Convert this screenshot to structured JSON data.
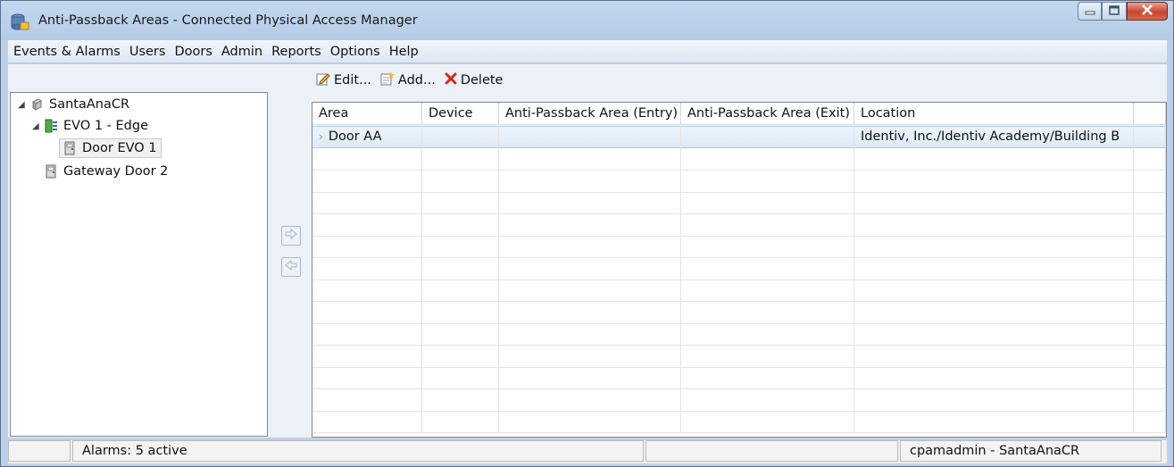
{
  "window": {
    "title": "Anti-Passback Areas - Connected Physical Access Manager",
    "app_icon": "database-icon",
    "controls": {
      "minimize": "minimize-icon",
      "maximize": "maximize-icon",
      "close": "close-icon"
    }
  },
  "menu": {
    "items": [
      "Events & Alarms",
      "Users",
      "Doors",
      "Admin",
      "Reports",
      "Options",
      "Help"
    ]
  },
  "toolbar": {
    "edit_label": "Edit...",
    "add_label": "Add...",
    "delete_label": "Delete"
  },
  "tree": {
    "nodes": [
      {
        "label": "SantaAnaCR",
        "icon": "server-icon",
        "expanded": true
      },
      {
        "label": "EVO 1 - Edge",
        "icon": "controller-icon",
        "expanded": true
      },
      {
        "label": "Door EVO 1",
        "icon": "door-icon"
      },
      {
        "label": "Gateway Door 2",
        "icon": "door-icon"
      }
    ]
  },
  "grid": {
    "columns": [
      "Area",
      "Device",
      "Anti-Passback Area (Entry)",
      "Anti-Passback Area (Exit)",
      "Location"
    ],
    "rows": [
      {
        "area": "Door AA",
        "device": "",
        "entry": "",
        "exit": "",
        "location": "Identiv, Inc./Identiv Academy/Building B",
        "selected": true
      }
    ]
  },
  "status": {
    "alarms": "Alarms: 5 active",
    "user": "cpamadmin - SantaAnaCR"
  },
  "colors": {
    "frame": "#bcd1e7",
    "selection": "#dde9f8",
    "close_button": "#c9452f",
    "delete_icon": "#d22a1e"
  }
}
